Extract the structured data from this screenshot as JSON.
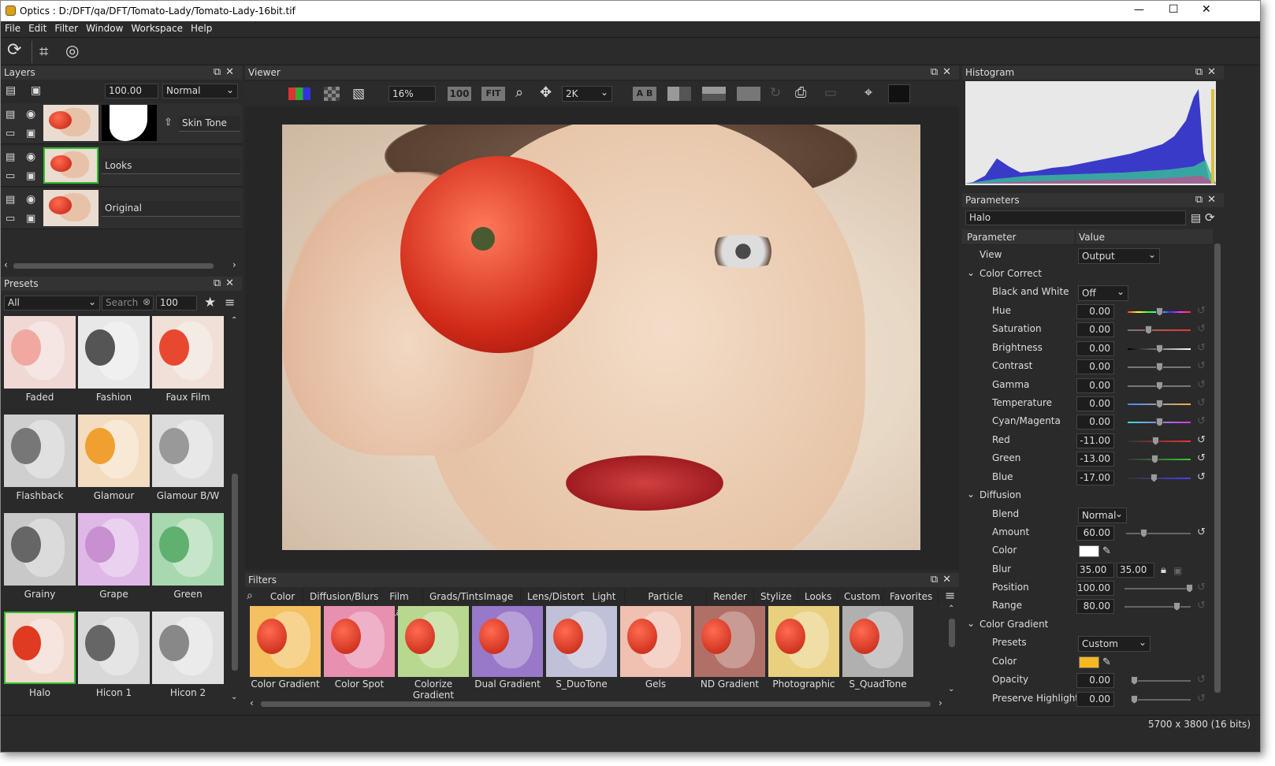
{
  "app": {
    "title": "Optics : D:/DFT/qa/DFT/Tomato-Lady/Tomato-Lady-16bit.tif",
    "minimize": "—",
    "maximize": "☐",
    "close": "✕"
  },
  "menu": [
    "File",
    "Edit",
    "Filter",
    "Window",
    "Workspace",
    "Help"
  ],
  "layers": {
    "title": "Layers",
    "opacity": "100.00",
    "blend": "Normal",
    "items": [
      {
        "name": "Skin Tone"
      },
      {
        "name": "Looks"
      },
      {
        "name": "Original"
      }
    ]
  },
  "presets": {
    "title": "Presets",
    "category": "All",
    "search_placeholder": "Search",
    "size": "100",
    "items": [
      "Faded",
      "Fashion",
      "Faux Film",
      "Flashback",
      "Glamour",
      "Glamour B/W",
      "Grainy",
      "Grape",
      "Green",
      "Halo",
      "Hicon 1",
      "Hicon 2"
    ]
  },
  "viewer": {
    "title": "Viewer",
    "zoom": "16%",
    "btn100": "100",
    "fit": "FIT",
    "res": "2K",
    "ab": "A B"
  },
  "filters": {
    "title": "Filters",
    "tabs": [
      "Color",
      "Diffusion/Blurs",
      "Film Lab",
      "Grads/Tints",
      "Image",
      "Lens/Distort",
      "Light",
      "Particle Illusion",
      "Render",
      "Stylize",
      "Looks",
      "Custom",
      "Favorites"
    ],
    "items": [
      "Color Gradient",
      "Color Spot",
      "Colorize Gradient",
      "Dual Gradient",
      "S_DuoTone",
      "Gels",
      "ND Gradient",
      "Photographic",
      "S_QuadTone"
    ]
  },
  "histogram": {
    "title": "Histogram"
  },
  "params": {
    "title": "Parameters",
    "filter_name": "Halo",
    "col_param": "Parameter",
    "col_value": "Value",
    "view_label": "View",
    "view_value": "Output",
    "cc_title": "Color Correct",
    "bw_label": "Black and White",
    "bw_value": "Off",
    "cc": [
      {
        "n": "Hue",
        "v": "0.00",
        "k": 0.5
      },
      {
        "n": "Saturation",
        "v": "0.00",
        "k": 0.33
      },
      {
        "n": "Brightness",
        "v": "0.00",
        "k": 0.5
      },
      {
        "n": "Contrast",
        "v": "0.00",
        "k": 0.5
      },
      {
        "n": "Gamma",
        "v": "0.00",
        "k": 0.5
      },
      {
        "n": "Temperature",
        "v": "0.00",
        "k": 0.5
      },
      {
        "n": "Cyan/Magenta",
        "v": "0.00",
        "k": 0.5
      },
      {
        "n": "Red",
        "v": "-11.00",
        "k": 0.44
      },
      {
        "n": "Green",
        "v": "-13.00",
        "k": 0.43
      },
      {
        "n": "Blue",
        "v": "-17.00",
        "k": 0.41
      }
    ],
    "diff_title": "Diffusion",
    "blend_label": "Blend",
    "blend_value": "Normal",
    "amount_label": "Amount",
    "amount_value": "60.00",
    "color_label": "Color",
    "color_value": "#ffffff",
    "blur_label": "Blur",
    "blur_x": "35.00",
    "blur_y": "35.00",
    "position_label": "Position",
    "position_value": "100.00",
    "range_label": "Range",
    "range_value": "80.00",
    "cg_title": "Color Gradient",
    "presets_label": "Presets",
    "presets_value": "Custom",
    "cg_color_label": "Color",
    "cg_color_value": "#f5b820",
    "opacity_label": "Opacity",
    "opacity_value": "0.00",
    "ph_label": "Preserve Highlights",
    "ph_value": "0.00"
  },
  "status": "5700 x 3800 (16 bits)"
}
